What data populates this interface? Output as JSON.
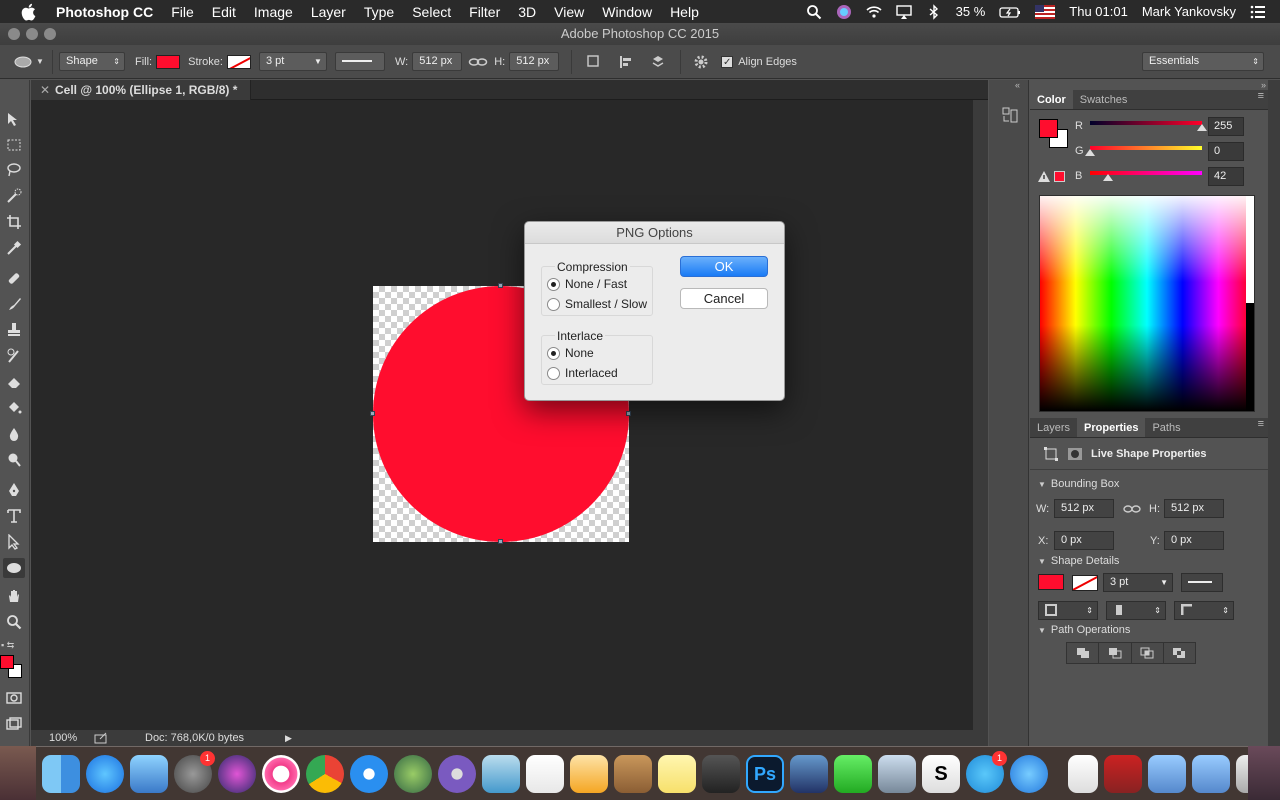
{
  "menubar": {
    "app_name": "Photoshop CC",
    "items": [
      "File",
      "Edit",
      "Image",
      "Layer",
      "Type",
      "Select",
      "Filter",
      "3D",
      "View",
      "Window",
      "Help"
    ],
    "battery": "35 %",
    "time": "Thu 01:01",
    "user": "Mark Yankovsky"
  },
  "window": {
    "title": "Adobe Photoshop CC 2015"
  },
  "options_bar": {
    "mode": "Shape",
    "fill_label": "Fill:",
    "stroke_label": "Stroke:",
    "stroke_width": "3 pt",
    "w_label": "W:",
    "w_value": "512 px",
    "h_label": "H:",
    "h_value": "512 px",
    "align_edges": "Align Edges",
    "workspace": "Essentials"
  },
  "document": {
    "tab_title": "Cell @ 100% (Ellipse 1, RGB/8) *",
    "zoom": "100%",
    "doc_info": "Doc: 768,0K/0 bytes",
    "fill_color": "#ff0d2e"
  },
  "color_panel": {
    "tabs": [
      "Color",
      "Swatches"
    ],
    "r_label": "R",
    "r_value": "255",
    "g_label": "G",
    "g_value": "0",
    "b_label": "B",
    "b_value": "42"
  },
  "properties_panel": {
    "tabs": [
      "Layers",
      "Properties",
      "Paths"
    ],
    "header": "Live Shape Properties",
    "bounding_box": "Bounding Box",
    "w_label": "W:",
    "w_value": "512 px",
    "h_label": "H:",
    "h_value": "512 px",
    "x_label": "X:",
    "x_value": "0 px",
    "y_label": "Y:",
    "y_value": "0 px",
    "shape_details": "Shape Details",
    "stroke_width": "3 pt",
    "path_operations": "Path Operations"
  },
  "dialog": {
    "title": "PNG Options",
    "compression_label": "Compression",
    "compression_options": [
      "None / Fast",
      "Smallest / Slow"
    ],
    "compression_selected": "None / Fast",
    "interlace_label": "Interlace",
    "interlace_options": [
      "None",
      "Interlaced"
    ],
    "interlace_selected": "None",
    "ok_label": "OK",
    "cancel_label": "Cancel"
  },
  "dock": {
    "icons": [
      "finder-icon",
      "app-store-icon",
      "preview-icon",
      "system-preferences-icon",
      "siri-icon",
      "itunes-icon",
      "chrome-icon",
      "safari-icon",
      "globe-icon",
      "torrent-icon",
      "keynote-icon",
      "numbers-icon",
      "pages-icon",
      "contacts-icon",
      "notes-icon",
      "sublime-icon",
      "photoshop-icon",
      "xcode-icon",
      "facetime-icon",
      "mail-icon",
      "skype-icon",
      "telegram-icon",
      "messages-icon"
    ],
    "badge_system_prefs": "1",
    "badge_telegram": "1",
    "ps_label": "Ps"
  }
}
